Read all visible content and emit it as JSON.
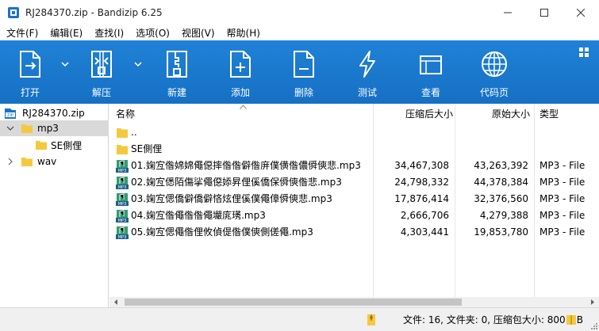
{
  "window": {
    "title": "RJ284370.zip - Bandizip 6.25",
    "minimize": "minimize",
    "maximize": "maximize",
    "close": "close"
  },
  "menu": [
    "文件(F)",
    "编辑(E)",
    "查找(I)",
    "选项(O)",
    "视图(V)",
    "帮助(H)"
  ],
  "toolbar": {
    "open": "打开",
    "extract": "解压",
    "new": "新建",
    "add": "添加",
    "delete": "删除",
    "test": "测试",
    "view": "查看",
    "codepage": "代码页"
  },
  "tree": {
    "root": "RJ284370.zip",
    "mp3": "mp3",
    "se": "SE側俚",
    "wav": "wav"
  },
  "columns": {
    "name": "名称",
    "packed": "压缩后大小",
    "original": "原始大小",
    "type": "类型"
  },
  "files": [
    {
      "name": "..",
      "packed": "",
      "original": "",
      "type": "",
      "icon": "folder"
    },
    {
      "name": "SE側俚",
      "packed": "",
      "original": "",
      "type": "",
      "icon": "folder"
    },
    {
      "name": "01.婅宐偺婂婂僶僫摔偺偺僻偺庰僕僙偺儂僢傸悲.mp3",
      "packed": "34,467,308",
      "original": "43,263,392",
      "type": "MP3 - File",
      "icon": "mp3"
    },
    {
      "name": "02.婅宐僁陌傷挲僶僫婖昇俚傒僑保僢傸偺悲.mp3",
      "packed": "24,798,332",
      "original": "44,378,384",
      "type": "MP3 - File",
      "icon": "mp3"
    },
    {
      "name": "03.婅宐偲僑僻僑僻悋炫俚傒僕僶傽僢傸悲.mp3",
      "packed": "17,876,414",
      "original": "32,376,560",
      "type": "MP3 - File",
      "icon": "mp3"
    },
    {
      "name": "04.婅宐偺僶偺偺僶壧庣璓.mp3",
      "packed": "2,666,706",
      "original": "4,279,388",
      "type": "MP3 - File",
      "icon": "mp3"
    },
    {
      "name": "05.婅宐偲僶偺俚攸偵偍偺僕傸側傞僶.mp3",
      "packed": "4,303,441",
      "original": "19,853,780",
      "type": "MP3 - File",
      "icon": "mp3"
    }
  ],
  "status": {
    "text": "文件: 16, 文件夹: 0, 压缩包大小: 800 MB"
  },
  "colors": {
    "toolbar": "#1670c4",
    "folder": "#f5c93e",
    "selection": "#d9d9d9"
  }
}
